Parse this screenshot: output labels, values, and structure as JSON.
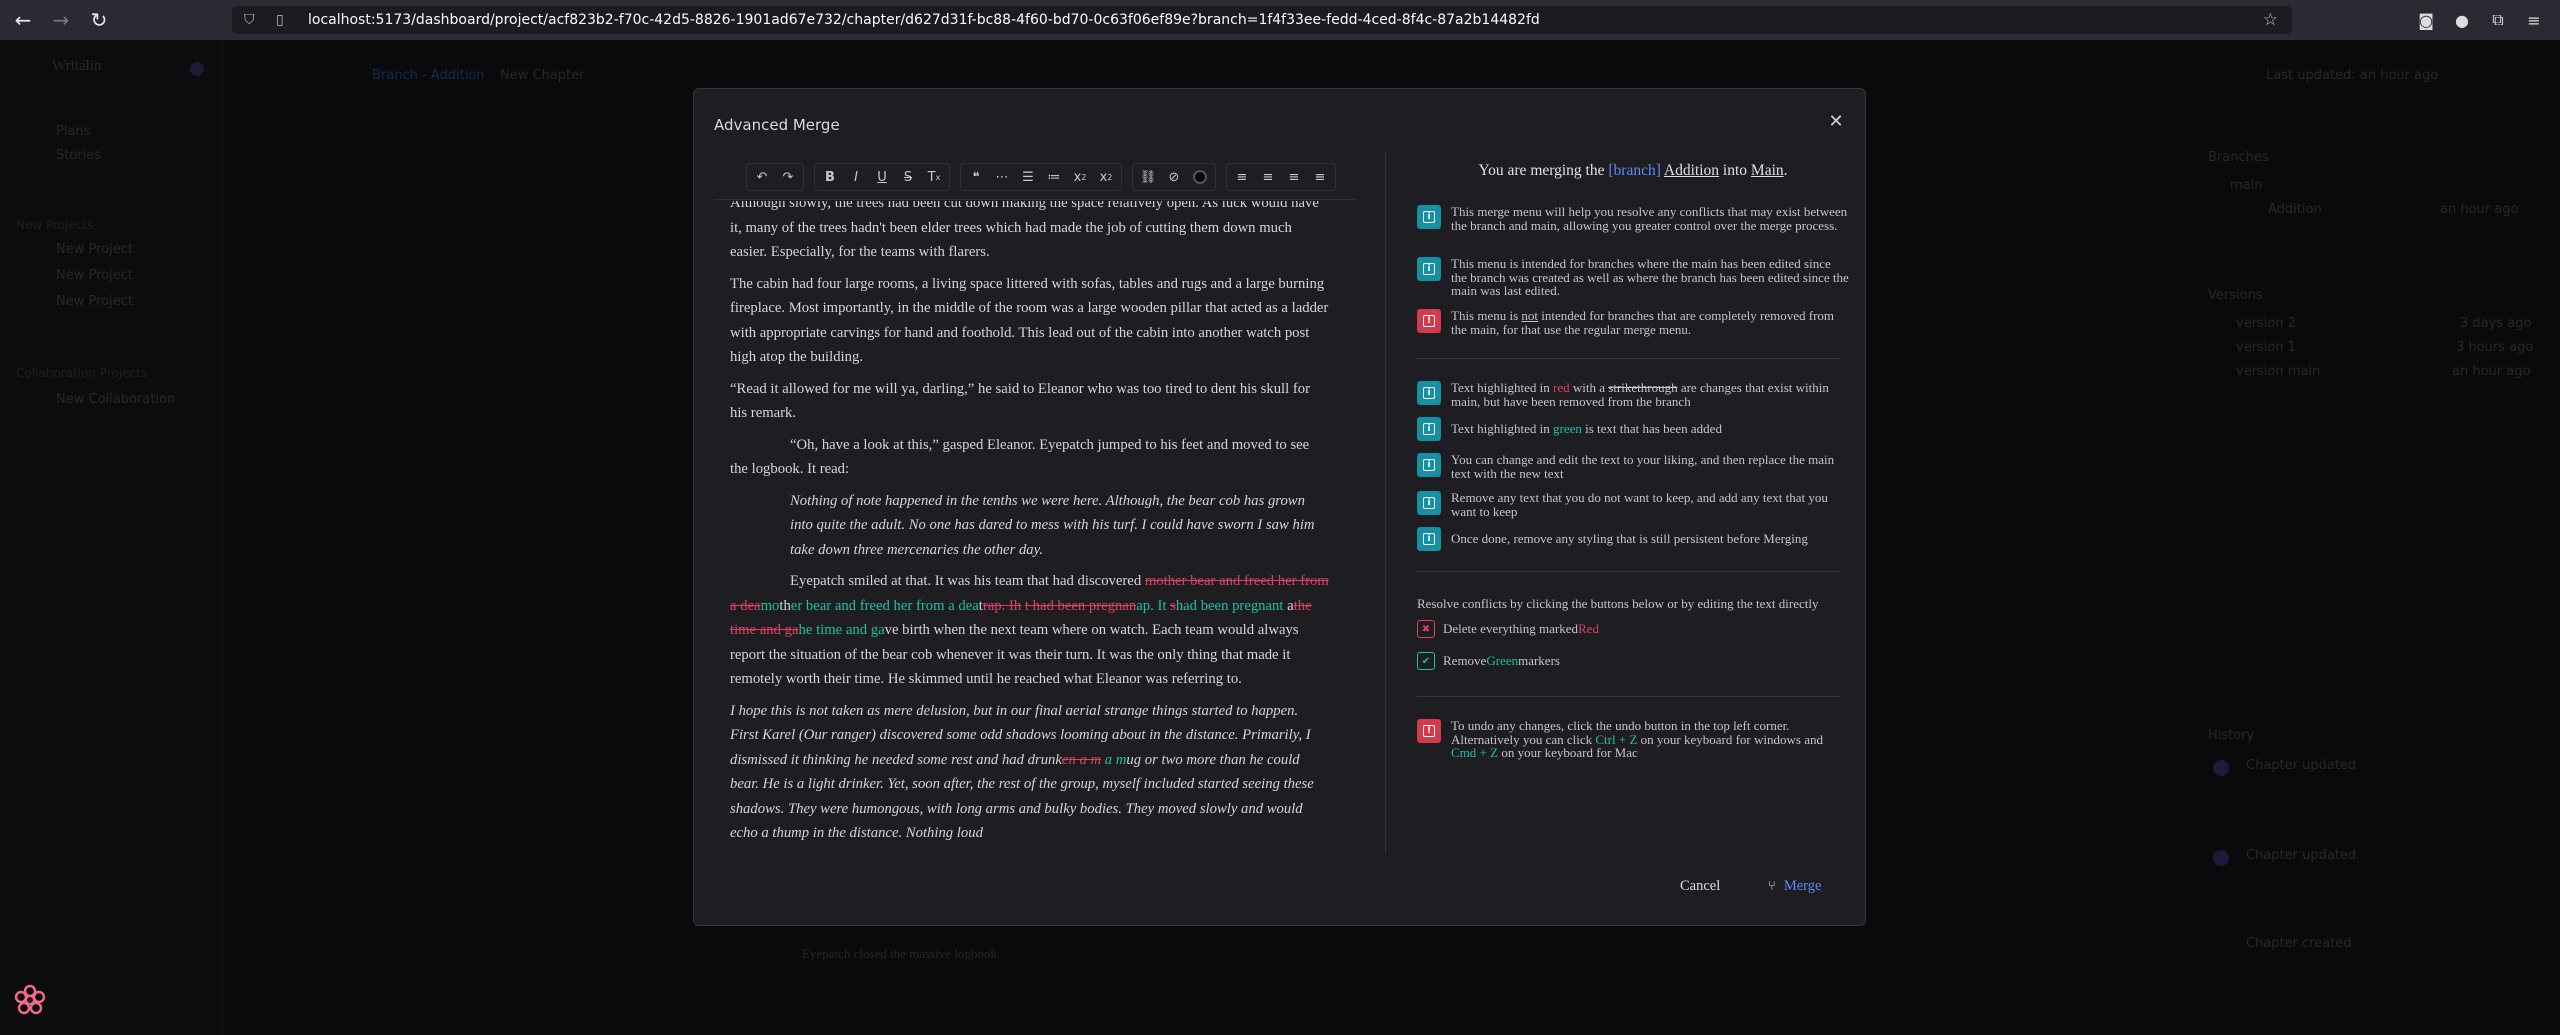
{
  "browser": {
    "url": "localhost:5173/dashboard/project/acf823b2-f70c-42d5-8826-1901ad67e732/chapter/d627d31f-bc88-4f60-bd70-0c63f06ef89e?branch=1f4f33ee-fedd-4ced-8f4c-87a2b14482fd",
    "back_icon": "arrow-left-icon",
    "forward_icon": "arrow-right-icon",
    "reload_icon": "reload-icon"
  },
  "background_app": {
    "brand": "Writalin",
    "sidebar_items": [
      "Plans",
      "Stories"
    ],
    "projects_heading": "New Projects",
    "projects": [
      "New Project",
      "New Project",
      "New Project"
    ],
    "collab_heading": "Collaboration Projects",
    "collab_items": [
      "New Collaboration"
    ],
    "breadcrumb_branch": "Branch - Addition",
    "breadcrumb_chapter": "New Chapter",
    "last_updated": "Last updated: an hour ago",
    "branches_heading": "Branches",
    "branch_main": "main",
    "branch_addition": "Addition",
    "branch_time": "an hour ago",
    "versions_heading": "Versions",
    "versions": [
      {
        "name": "version 2",
        "time": "3 days ago"
      },
      {
        "name": "version 1",
        "time": "3 hours ago"
      },
      {
        "name": "version main",
        "time": "an hour ago"
      }
    ],
    "history_heading": "History",
    "history": [
      "Chapter updated",
      "Chapter updated",
      "Chapter created"
    ],
    "bottom_text": "Eyepatch closed the massive logbook."
  },
  "modal": {
    "title": "Advanced Merge",
    "cancel_label": "Cancel",
    "merge_label": "Merge",
    "heading": {
      "prefix": "You are merging the ",
      "branch_tag": "[branch]",
      "branch_name": "Addition",
      "middle": " into ",
      "target": "Main",
      "suffix": "."
    }
  },
  "editor": {
    "p1": "Although slowly, the trees had been cut down making the space relatively open. As luck would have it, many of the trees hadn't been elder trees which had made the job of cutting them down much easier. Especially, for the teams with flarers.",
    "p2": "The cabin had four large rooms, a living space littered with sofas, tables and rugs and a large burning fireplace. Most importantly, in the middle of the room was a large wooden pillar that acted as a ladder with appropriate carvings for hand and foothold. This lead out of the cabin into another watch post high atop the building.",
    "p3": "“Read it allowed for me will ya, darling,” he said to Eleanor who was too tired to dent his skull for his remark.",
    "p4": "“Oh, have a look at this,” gasped Eleanor. Eyepatch jumped to his feet and moved to see the logbook. It read:",
    "p5": "Nothing of note happened in the tenths we were here. Although, the bear cob has grown into quite the adult. No one has dared to mess with his turf. I could have sworn I saw him take down three mercenaries the other day.",
    "p6": {
      "s1": "Eyepatch smiled at that. It was his team that had discovered ",
      "d1": "mo",
      "d2": "the",
      "d3": "r bear and freed her from a dea",
      "a1": "mo",
      "s2": "th",
      "a2": "er bear and freed her from a dea",
      "s3": "t",
      "d4": "rap. Ih",
      "s4": " ",
      "d5": "t",
      "d6": " had been pregnan",
      "a3": "ap. It ",
      "d7": "s",
      "a4": "had been pregnant",
      "s5": " a",
      "d8": "t",
      "d9": "he time and ga",
      "a5": "he time and ga",
      "s6": "ve birth when the next team where on watch. Each team would always report the situation of the bear cob whenever it was their turn. It was the only thing that made it remotely worth their time. He skimmed until he reached what Eleanor was referring to."
    },
    "p7": {
      "s1": "I hope this is not taken as mere delusion, but in our final aerial strange things started to happen. First Karel (Our ranger) discovered some odd shadows looming about in the distance. Primarily, I dismissed it thinking he needed some rest and had drunk",
      "d1": "en a m",
      "s2": " ",
      "a1": "a m",
      "s3": "ug or two more than he could bear. He is a light drinker. Yet, soon after, the rest of the group, myself included started seeing these shadows. They were humongous, with long arms and bulky bodies. They moved slowly and would echo a thump in the distance. Nothing loud"
    }
  },
  "info": {
    "i1": "This merge menu will help you resolve any conflicts that may exist between the branch and main, allowing you greater control over the merge process.",
    "i2": "This menu is intended for branches where the main has been edited since the branch was created as well as where the branch has been edited since the main was last edited.",
    "i3a": "This menu is ",
    "i3b": "not",
    "i3c": " intended for branches that are completely removed from the main, for that use the regular merge menu.",
    "h1a": "Text highlighted in ",
    "h1b": "red",
    "h1c": " with a ",
    "h1d": "strikethrough",
    "h1e": " are changes that exist within main, but have been removed from the branch",
    "h2a": "Text highlighted in ",
    "h2b": "green",
    "h2c": " is text that has been added",
    "h3": "You can change and edit the text to your liking, and then replace the main text with the new text",
    "h4": "Remove any text that you do not want to keep, and add any text that you want to keep",
    "h5": "Once done, remove any styling that is still persistent before Merging",
    "resolve": "Resolve conflicts by clicking the buttons below or by editing the text directly",
    "delete_a": "Delete everything marked ",
    "delete_b": "Red",
    "remove_a": "Remove ",
    "remove_b": "Green",
    "remove_c": " markers",
    "undo_a": "To undo any changes, click the undo button in the top left corner. Alternatively you can click ",
    "undo_b": "Ctrl + Z",
    "undo_c": " on your keyboard for windows and ",
    "undo_d": "Cmd + Z",
    "undo_e": " on your keyboard for Mac"
  },
  "colors": {
    "red": "#d8435f",
    "green": "#1ec1a2",
    "blue": "#5d8cf5",
    "teal_badge": "#1690a3",
    "red_badge": "#d33a4a"
  }
}
